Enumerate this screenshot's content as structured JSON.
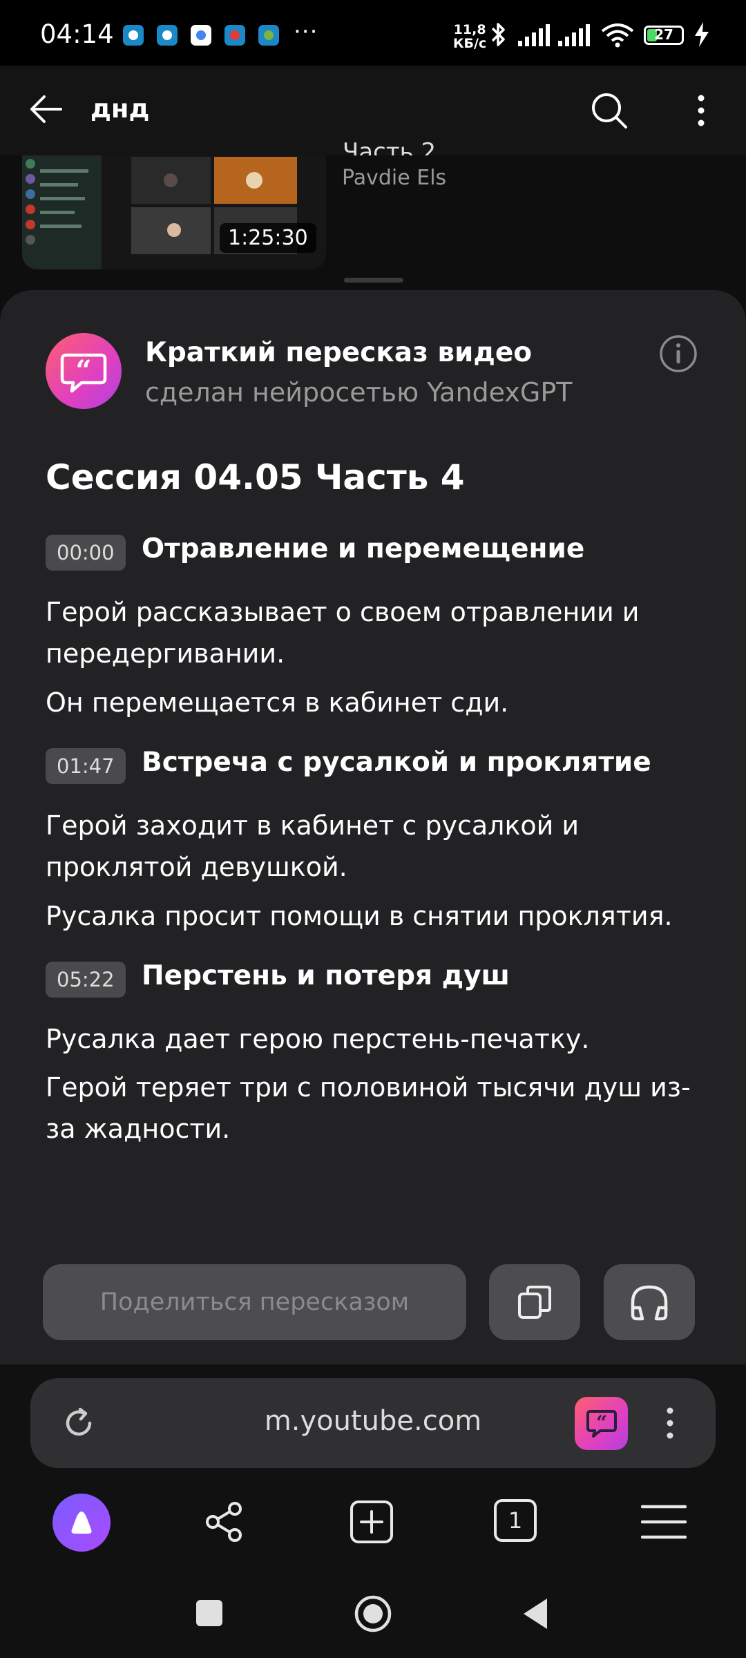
{
  "status_bar": {
    "time": "04:14",
    "more_notifications": "···",
    "net_speed_value": "11,8",
    "net_speed_unit": "КБ/с",
    "battery": "27"
  },
  "top_bar": {
    "search_query": "днд"
  },
  "video_card": {
    "title_partial": "Часть 2",
    "channel": "Pavdie Els",
    "duration": "1:25:30"
  },
  "summary": {
    "title": "Краткий пересказ видео",
    "subtitle": "сделан нейросетью YandexGPT",
    "video_title": "Сессия 04.05 Часть 4",
    "chapters": [
      {
        "time": "00:00",
        "title": "Отравление и перемещение",
        "points": [
          "Герой рассказывает о своем отравлении и передергивании.",
          "Он перемещается в кабинет сди."
        ]
      },
      {
        "time": "01:47",
        "title": "Встреча с русалкой и проклятие",
        "points": [
          "Герой заходит в кабинет с русалкой и проклятой девушкой.",
          "Русалка просит помощи в снятии проклятия."
        ]
      },
      {
        "time": "05:22",
        "title": "Перстень и потеря душ",
        "points": [
          "Русалка дает герою перстень-печатку.",
          "Герой теряет три с половиной тысячи душ из-за жадности."
        ]
      }
    ],
    "share_label": "Поделиться пересказом"
  },
  "address_bar": {
    "url": "m.youtube.com"
  },
  "toolbar": {
    "tabs_count": "1"
  },
  "colors": {
    "sheet_bg": "#222224",
    "accent_gradient_start": "#ff5f6d",
    "accent_gradient_end": "#b040e0",
    "alice_purple": "#8a4fff"
  }
}
